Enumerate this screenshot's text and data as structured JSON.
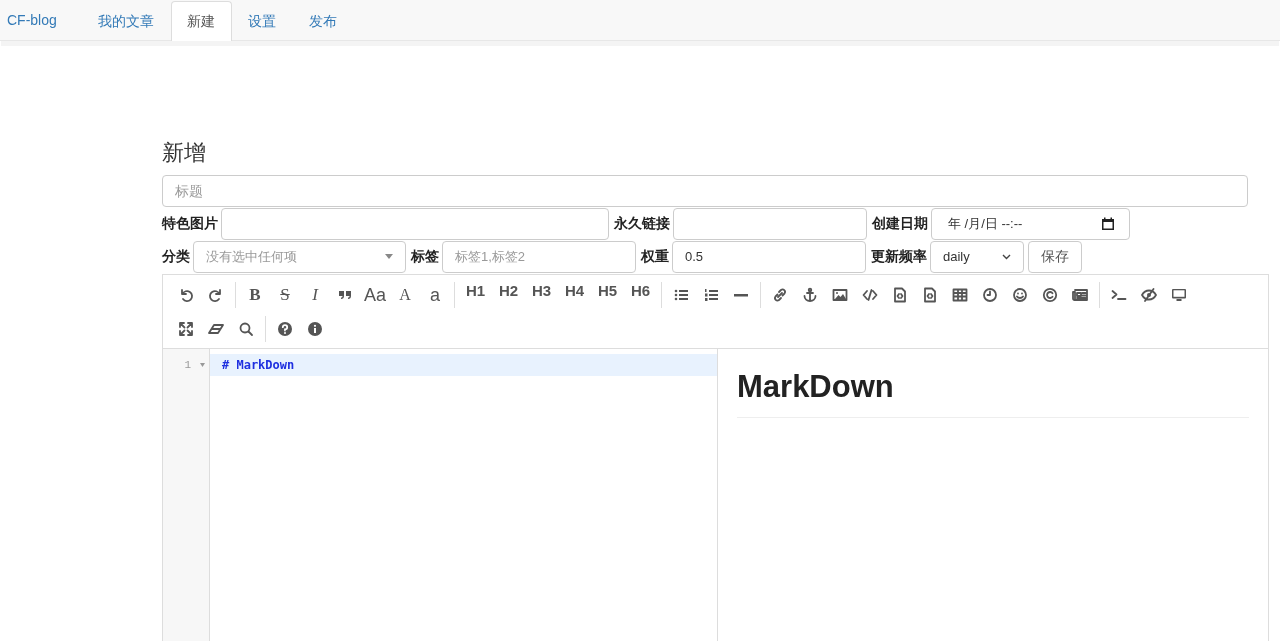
{
  "nav": {
    "brand": "CF-blog",
    "tabs": [
      {
        "label": "我的文章",
        "selected": false
      },
      {
        "label": "新建",
        "selected": true
      },
      {
        "label": "设置",
        "selected": false
      },
      {
        "label": "发布",
        "selected": false
      }
    ]
  },
  "heading": "新增",
  "title_field": {
    "placeholder": "标题"
  },
  "form_rows": [
    {
      "fields": [
        {
          "label": "特色图片",
          "kind": "input"
        },
        {
          "label": "永久链接",
          "kind": "input"
        },
        {
          "label": "创建日期",
          "kind": "date",
          "value": "年 /月/日 --:--"
        }
      ]
    },
    {
      "fields": [
        {
          "label": "分类",
          "kind": "select",
          "placeholder": "没有选中任何项"
        },
        {
          "label": "标签",
          "kind": "input",
          "placeholder": "标签1,标签2"
        },
        {
          "label": "权重",
          "kind": "input",
          "value": "0.5"
        },
        {
          "label": "更新频率",
          "kind": "dropdown",
          "value": "daily"
        }
      ]
    }
  ],
  "save_button": "保存",
  "toolbar_rows": [
    {
      "groups": [
        [
          {
            "kind": "icon"
          },
          {
            "kind": "icon"
          }
        ],
        [
          {
            "kind": "bold",
            "label": "B"
          },
          {
            "kind": "strike",
            "label": "S"
          },
          {
            "kind": "italic",
            "label": "I"
          },
          {
            "kind": "icon"
          },
          {
            "kind": "plain",
            "label": "Aa"
          },
          {
            "kind": "serif",
            "label": "A"
          },
          {
            "kind": "plain",
            "label": "a"
          }
        ],
        [
          {
            "kind": "heading",
            "label": "H1"
          },
          {
            "kind": "heading",
            "label": "H2"
          },
          {
            "kind": "heading",
            "label": "H3"
          },
          {
            "kind": "heading",
            "label": "H4"
          },
          {
            "kind": "heading",
            "label": "H5"
          },
          {
            "kind": "heading",
            "label": "H6"
          }
        ],
        [
          {
            "kind": "icon"
          },
          {
            "kind": "icon"
          },
          {
            "kind": "icon"
          }
        ],
        [
          {
            "kind": "icon"
          },
          {
            "kind": "icon"
          },
          {
            "kind": "icon"
          },
          {
            "kind": "icon"
          },
          {
            "kind": "icon"
          },
          {
            "kind": "icon"
          },
          {
            "kind": "icon"
          },
          {
            "kind": "icon"
          },
          {
            "kind": "icon"
          },
          {
            "kind": "icon"
          },
          {
            "kind": "icon"
          }
        ],
        [
          {
            "kind": "icon"
          },
          {
            "kind": "icon"
          },
          {
            "kind": "icon"
          }
        ]
      ]
    },
    {
      "groups": [
        [
          {
            "kind": "icon"
          },
          {
            "kind": "icon"
          },
          {
            "kind": "icon"
          }
        ],
        [
          {
            "kind": "icon"
          },
          {
            "kind": "icon"
          }
        ]
      ]
    }
  ],
  "editor": {
    "line_numbers": [
      "1"
    ],
    "code_lines": [
      "# MarkDown"
    ],
    "preview_heading": "MarkDown"
  }
}
